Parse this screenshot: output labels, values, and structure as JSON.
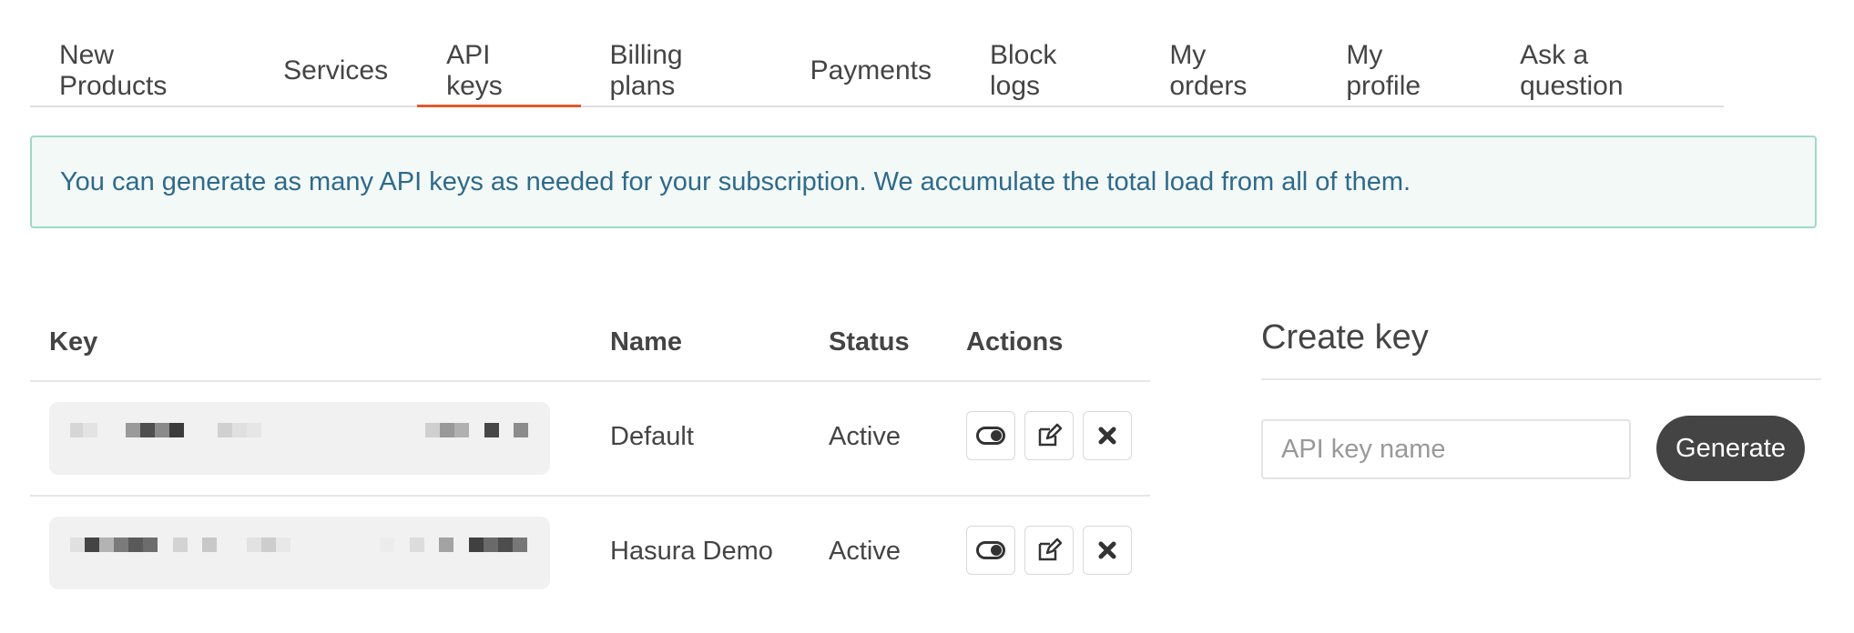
{
  "tabs": [
    {
      "label": "New Products",
      "active": false
    },
    {
      "label": "Services",
      "active": false
    },
    {
      "label": "API keys",
      "active": true
    },
    {
      "label": "Billing plans",
      "active": false
    },
    {
      "label": "Payments",
      "active": false
    },
    {
      "label": "Block logs",
      "active": false
    },
    {
      "label": "My orders",
      "active": false
    },
    {
      "label": "My profile",
      "active": false
    },
    {
      "label": "Ask a question",
      "active": false
    }
  ],
  "alert": {
    "text": "You can generate as many API keys as needed for your subscription. We accumulate the total load from all of them."
  },
  "table": {
    "headers": {
      "key": "Key",
      "name": "Name",
      "status": "Status",
      "actions": "Actions"
    },
    "rows": [
      {
        "key": "",
        "name": "Default",
        "status": "Active"
      },
      {
        "key": "",
        "name": "Hasura Demo",
        "status": "Active"
      }
    ],
    "action_icons": [
      "toggle-icon",
      "edit-icon",
      "close-icon"
    ]
  },
  "create": {
    "title": "Create key",
    "input_placeholder": "API key name",
    "input_value": "",
    "button_label": "Generate"
  },
  "colors": {
    "accent": "#e05a2b",
    "alert_bg": "#f2f9f7",
    "alert_border": "#9fd9c6",
    "alert_text": "#2f6a8a",
    "button_bg": "#444444"
  }
}
